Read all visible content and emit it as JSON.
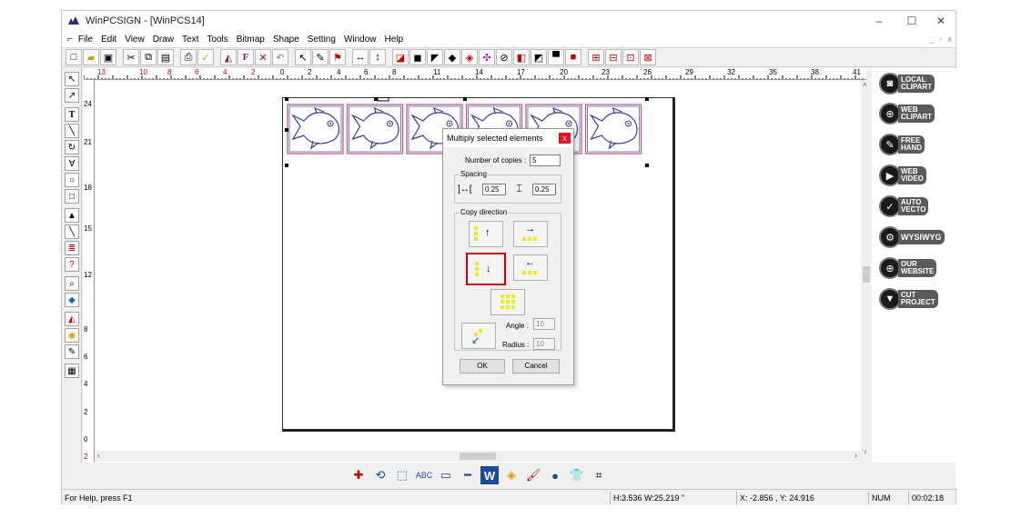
{
  "window": {
    "title": "WinPCSIGN - [WinPCS14]",
    "controls": {
      "minimize": "–",
      "maximize": "☐",
      "close": "✕"
    }
  },
  "menu": {
    "items": [
      "File",
      "Edit",
      "View",
      "Draw",
      "Text",
      "Tools",
      "Bitmap",
      "Shape",
      "Setting",
      "Window",
      "Help"
    ]
  },
  "ruler": {
    "h_labels": [
      "13",
      "10",
      "8",
      "6",
      "4",
      "2",
      "0",
      "2",
      "4",
      "6",
      "8",
      "11",
      "14",
      "17",
      "20",
      "23",
      "26",
      "29",
      "32",
      "35",
      "38",
      "41"
    ],
    "v_labels": [
      "24",
      "21",
      "18",
      "15",
      "12",
      "8",
      "6",
      "4",
      "2",
      "0",
      "2"
    ]
  },
  "right_panel": {
    "buttons": [
      {
        "line1": "LOCAL",
        "line2": "CLIPART",
        "icon": "cd-icon"
      },
      {
        "line1": "WEB",
        "line2": "CLIPART",
        "icon": "globe-icon"
      },
      {
        "line1": "FREE",
        "line2": "HAND",
        "icon": "pen-icon"
      },
      {
        "line1": "WEB",
        "line2": "VIDEO",
        "icon": "video-icon"
      },
      {
        "line1": "AUTO",
        "line2": "VECTO",
        "icon": "vector-icon"
      },
      {
        "line1": "WYSIWYG",
        "line2": "",
        "icon": "gear-icon"
      },
      {
        "line1": "OUR",
        "line2": "WEBSITE",
        "icon": "globe-icon"
      },
      {
        "line1": "CUT",
        "line2": "PROJECT",
        "icon": "plotter-icon"
      }
    ]
  },
  "status": {
    "help": "For Help, press F1",
    "size": "H:3.536   W:25.219  \"",
    "coords": "X: -2.856 , Y: 24.916",
    "num": "NUM",
    "time": "00:02:18"
  },
  "dialog": {
    "title": "Multiply selected elements",
    "close": "x",
    "copies_label": "Number of copies :",
    "copies_value": "5",
    "spacing_label": "Spacing",
    "spacing_h_value": "0.25",
    "spacing_v_value": "0.25",
    "copy_direction_label": "Copy direction",
    "selected_direction": "down",
    "angle_label": "Angle :",
    "angle_value": "10",
    "radius_label": "Radius :",
    "radius_value": "10",
    "ok_label": "OK",
    "cancel_label": "Cancel"
  },
  "canvas": {
    "fish_count": 6,
    "fish_color": "#3a3a9a",
    "frame_color": "#c0507a"
  }
}
